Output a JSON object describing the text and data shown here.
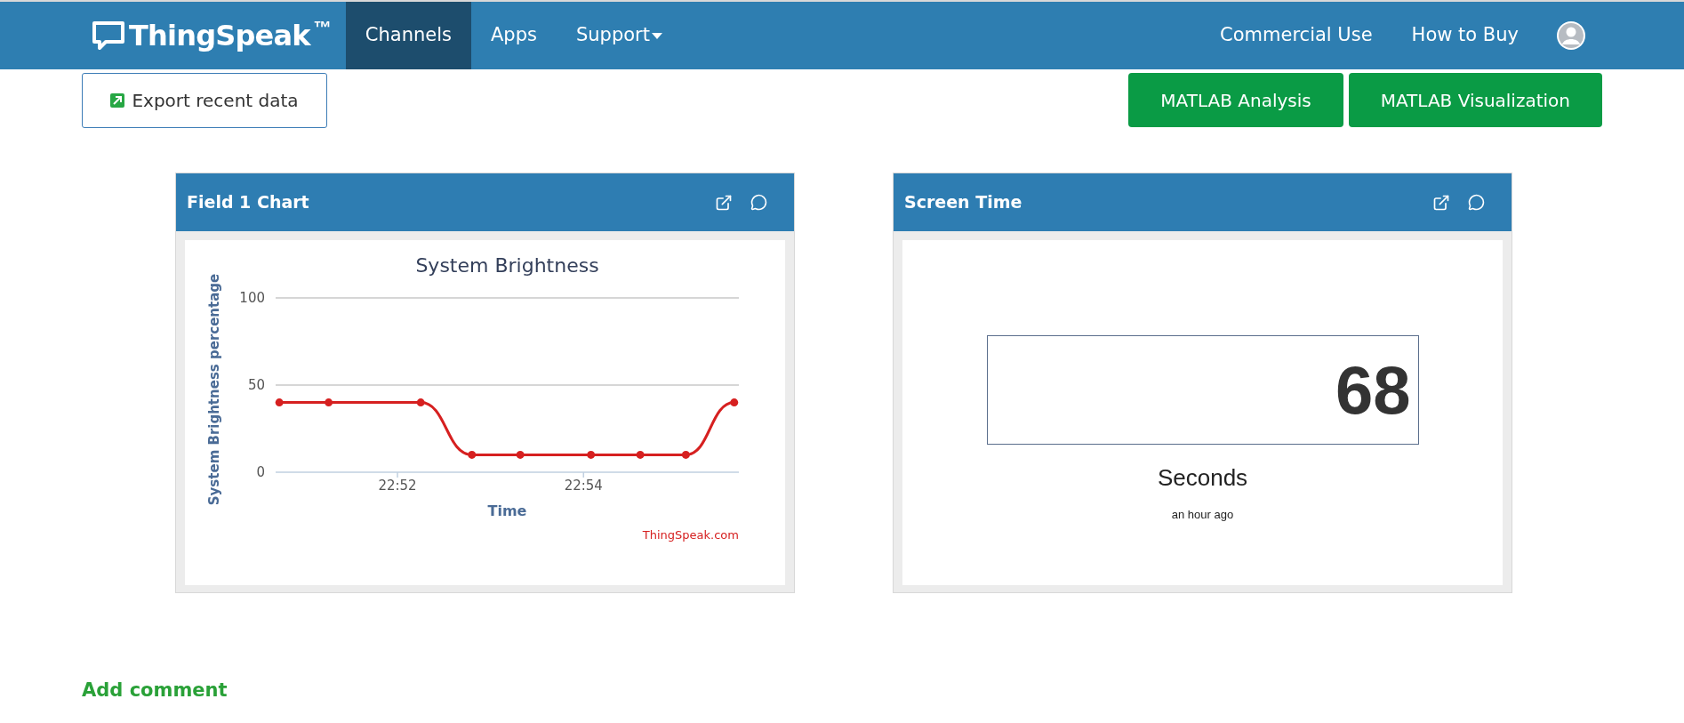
{
  "navbar": {
    "logo": {
      "name": "ThingSpeak",
      "mark": "™"
    },
    "items": [
      {
        "label": "Channels",
        "selected": true,
        "kind": "link"
      },
      {
        "label": "Apps",
        "selected": false,
        "kind": "link"
      },
      {
        "label": "Support",
        "selected": false,
        "kind": "dropdown"
      }
    ],
    "right_links": [
      "Commercial Use",
      "How to Buy"
    ]
  },
  "toolbar": {
    "export_button": "Export recent data",
    "buttons": [
      "MATLAB Analysis",
      "MATLAB Visualization"
    ]
  },
  "widgets": [
    {
      "kind": "chart",
      "title": "Field 1 Chart",
      "chart_data": {
        "type": "line",
        "title": "System Brightness",
        "xlabel": "Time",
        "ylabel": "System Brightness percentage",
        "x": [
          1370.73,
          1371.26,
          1372.25,
          1372.8,
          1373.32,
          1374.08,
          1374.61,
          1375.1,
          1375.62
        ],
        "series": [
          {
            "color": "#d62020",
            "marker": "circle",
            "values": [
              40,
              40,
              40,
              10,
              10,
              10,
              10,
              10,
              40
            ]
          }
        ],
        "xlim": [
          1370.69,
          1375.67
        ],
        "ylim": [
          0,
          100
        ],
        "xticks": [
          {
            "value": 1372,
            "label": "22:52"
          },
          {
            "value": 1374,
            "label": "22:54"
          }
        ],
        "yticks": [
          0,
          50,
          100
        ],
        "annotations": [
          "ThingSpeak.com"
        ]
      }
    },
    {
      "kind": "numeric",
      "title": "Screen Time",
      "value": "68",
      "unit": "Seconds",
      "updated": "an hour ago"
    }
  ],
  "add_comment": "Add comment"
}
